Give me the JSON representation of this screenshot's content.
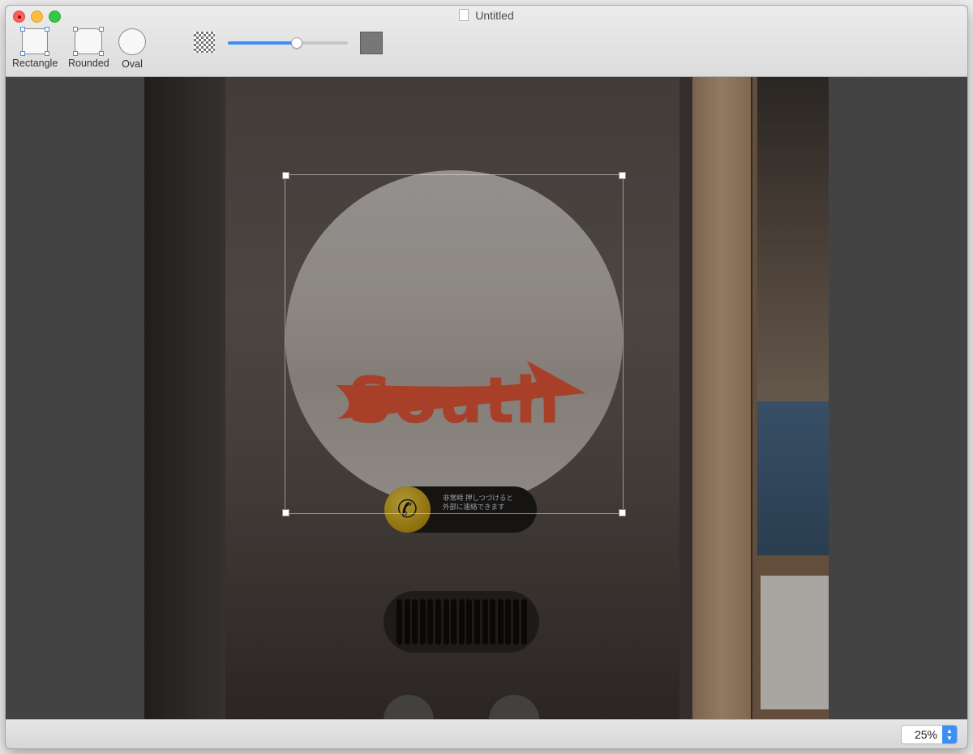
{
  "window": {
    "title": "Untitled",
    "controls": [
      "close",
      "minimize",
      "zoom"
    ]
  },
  "toolbar": {
    "tools": [
      {
        "label": "Rectangle",
        "icon": "rectangle-shape-icon"
      },
      {
        "label": "Rounded",
        "icon": "rounded-rectangle-shape-icon"
      },
      {
        "label": "Oval",
        "icon": "oval-shape-icon"
      }
    ],
    "opacity": {
      "icon": "transparency-checker-icon",
      "value_fraction": 0.57,
      "swatch_color": "#777777"
    },
    "accent_color": "#3d8ff5"
  },
  "canvas": {
    "photo": {
      "sign_text": "South",
      "sign_color": "#e8583a",
      "intercom_text_line1": "非常時 押しつづけると",
      "intercom_text_line2": "外部に連絡できます"
    },
    "selection": {
      "shape": "rounded-rectangle-handles"
    }
  },
  "statusbar": {
    "zoom": "25%"
  }
}
